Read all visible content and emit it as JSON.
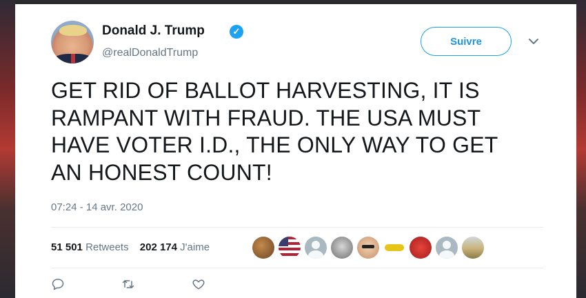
{
  "tweet": {
    "display_name": "Donald J. Trump",
    "handle": "@realDonaldTrump",
    "follow_label": "Suivre",
    "text": "GET RID OF BALLOT HARVESTING, IT IS\nRAMPANT WITH FRAUD. THE USA MUST\nHAVE VOTER I.D., THE ONLY WAY TO GET\nAN HONEST COUNT!",
    "timestamp": "07:24 - 14 avr. 2020"
  },
  "stats": {
    "retweets_count": "51 501",
    "retweets_label": "Retweets",
    "likes_count": "202 174",
    "likes_label": "J'aime"
  },
  "likers": [
    {
      "icon": "avatar-dog"
    },
    {
      "icon": "avatar-us-flag"
    },
    {
      "icon": "avatar-default"
    },
    {
      "icon": "avatar-photo-gray"
    },
    {
      "icon": "avatar-woman-sunglasses"
    },
    {
      "icon": "avatar-yellow-logo"
    },
    {
      "icon": "avatar-red-heart"
    },
    {
      "icon": "avatar-default"
    },
    {
      "icon": "avatar-outdoor-person"
    }
  ],
  "actions": [
    "reply-icon",
    "retweet-icon",
    "like-icon"
  ],
  "colors": {
    "accent": "#1da1f2",
    "text": "#14171a",
    "muted": "#657786"
  }
}
